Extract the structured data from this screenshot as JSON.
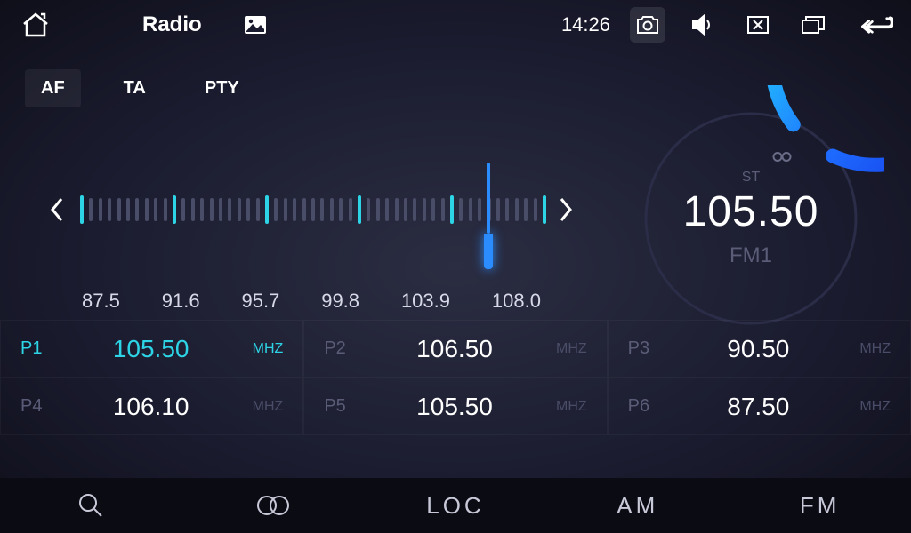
{
  "statusbar": {
    "title": "Radio",
    "time": "14:26"
  },
  "modes": {
    "af": "AF",
    "ta": "TA",
    "pty": "PTY"
  },
  "dial": {
    "labels": [
      "87.5",
      "91.6",
      "95.7",
      "99.8",
      "103.9",
      "108.0"
    ],
    "min": 87.5,
    "max": 108.0,
    "current": 105.5
  },
  "display": {
    "st_label": "ST",
    "loop_label": "∞",
    "frequency": "105.50",
    "band": "FM1"
  },
  "presets": [
    {
      "name": "P1",
      "freq": "105.50",
      "unit": "MHZ",
      "active": true
    },
    {
      "name": "P2",
      "freq": "106.50",
      "unit": "MHZ",
      "active": false
    },
    {
      "name": "P3",
      "freq": "90.50",
      "unit": "MHZ",
      "active": false
    },
    {
      "name": "P4",
      "freq": "106.10",
      "unit": "MHZ",
      "active": false
    },
    {
      "name": "P5",
      "freq": "105.50",
      "unit": "MHZ",
      "active": false
    },
    {
      "name": "P6",
      "freq": "87.50",
      "unit": "MHZ",
      "active": false
    }
  ],
  "bottombar": {
    "loc": "LOC",
    "am": "AM",
    "fm": "FM"
  }
}
